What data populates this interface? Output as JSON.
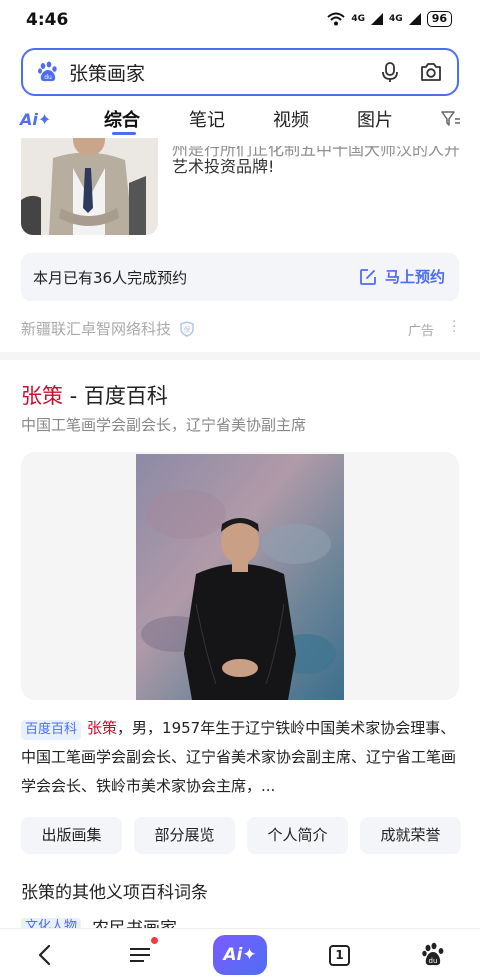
{
  "status_bar": {
    "time": "4:46",
    "network1": "4G",
    "network2": "4G",
    "battery": "96"
  },
  "search": {
    "query": "张策画家",
    "logo_icon": "baidu-paw-icon",
    "mic_icon": "microphone-icon",
    "camera_icon": "camera-icon"
  },
  "tabs": {
    "ai": "Ai✦",
    "items": [
      "综合",
      "笔记",
      "视频",
      "图片"
    ],
    "active": "综合",
    "filter_icon": "filter-icon"
  },
  "ad": {
    "text_line1": "州是行所们正化制五中十国大师汉的人开",
    "text_line2": "艺术投资品牌!",
    "booking_count": "本月已有36人完成预约",
    "booking_button": "马上预约",
    "advertiser": "新疆联汇卓智网络科技",
    "ad_label": "广告"
  },
  "result": {
    "title_highlight": "张策",
    "title_rest": " - 百度百科",
    "subtitle": "中国工笔画学会副会长，辽宁省美协副主席",
    "source_tag": "百度百科",
    "desc_name": "张策",
    "desc_text": "，男，1957年生于辽宁铁岭中国美术家协会理事、中国工笔画学会副会长、辽宁省美术家协会副主席、辽宁省工笔画学会会长、铁岭市美术家协会主席，...",
    "chips": [
      "出版画集",
      "部分展览",
      "个人简介",
      "成就荣誉"
    ],
    "other_heading": "张策的其他义项百科词条",
    "peek_tag": "文化人物",
    "peek_text": "农民书画家"
  },
  "bottom_nav": {
    "ai_label": "Ai✦",
    "tab_count": "1"
  }
}
